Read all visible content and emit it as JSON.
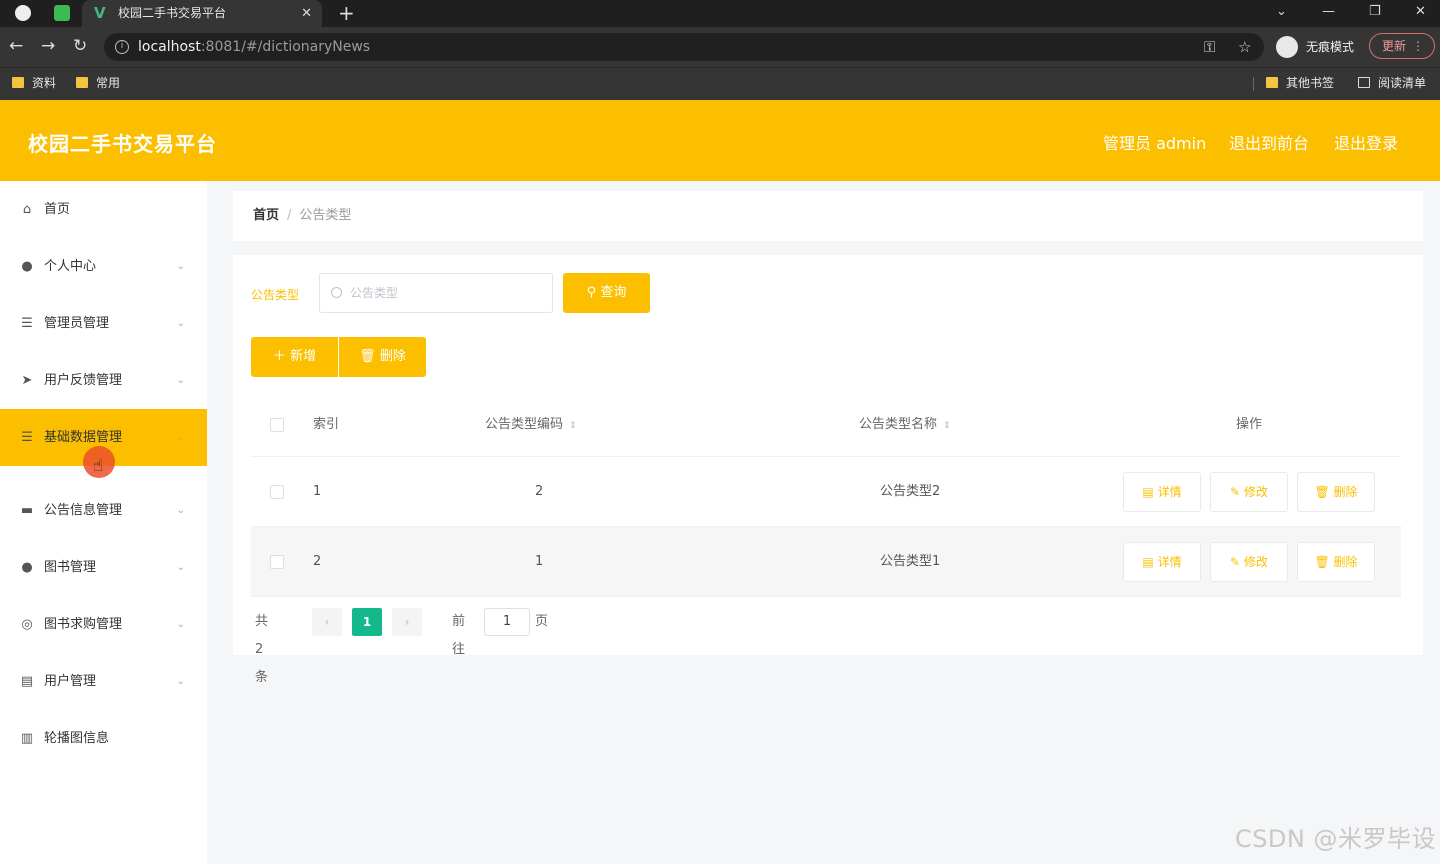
{
  "browser": {
    "tab_title": "校园二手书交易平台",
    "url_host": "localhost",
    "url_rest": ":8081/#/dictionaryNews",
    "incognito_label": "无痕模式",
    "update_label": "更新",
    "bookmarks": [
      "资料",
      "常用"
    ],
    "bookmarks_right": [
      "其他书签",
      "阅读清单"
    ]
  },
  "header": {
    "title": "校园二手书交易平台",
    "admin_label": "管理员 admin",
    "to_front_label": "退出到前台",
    "logout_label": "退出登录",
    "accent_color": "#fbbf00"
  },
  "sidebar": {
    "items": [
      {
        "label": "首页",
        "icon": "home-icon"
      },
      {
        "label": "个人中心",
        "icon": "user-icon"
      },
      {
        "label": "管理员管理",
        "icon": "list-icon"
      },
      {
        "label": "用户反馈管理",
        "icon": "send-icon"
      },
      {
        "label": "基础数据管理",
        "icon": "list-icon"
      },
      {
        "label": "公告信息管理",
        "icon": "monitor-icon"
      },
      {
        "label": "图书管理",
        "icon": "user-icon"
      },
      {
        "label": "图书求购管理",
        "icon": "target-icon"
      },
      {
        "label": "用户管理",
        "icon": "printer-icon"
      },
      {
        "label": "轮播图信息",
        "icon": "bar-chart-icon"
      }
    ],
    "active_index": 4
  },
  "breadcrumb": {
    "home": "首页",
    "current": "公告类型"
  },
  "search": {
    "label": "公告类型",
    "placeholder": "公告类型",
    "query_button": "查询"
  },
  "actions": {
    "add_label": "新增",
    "delete_label": "删除"
  },
  "table": {
    "columns": [
      "索引",
      "公告类型编码",
      "公告类型名称",
      "操作"
    ],
    "rows": [
      {
        "index": "1",
        "code": "2",
        "name": "公告类型2"
      },
      {
        "index": "2",
        "code": "1",
        "name": "公告类型1"
      }
    ],
    "row_actions": {
      "detail": "详情",
      "edit": "修改",
      "delete": "删除"
    }
  },
  "pagination": {
    "total_text": "共 2 条",
    "current_page": "1",
    "goto_label": "前往",
    "goto_value": "1",
    "page_suffix": "页"
  },
  "watermark": "CSDN @米罗毕设"
}
